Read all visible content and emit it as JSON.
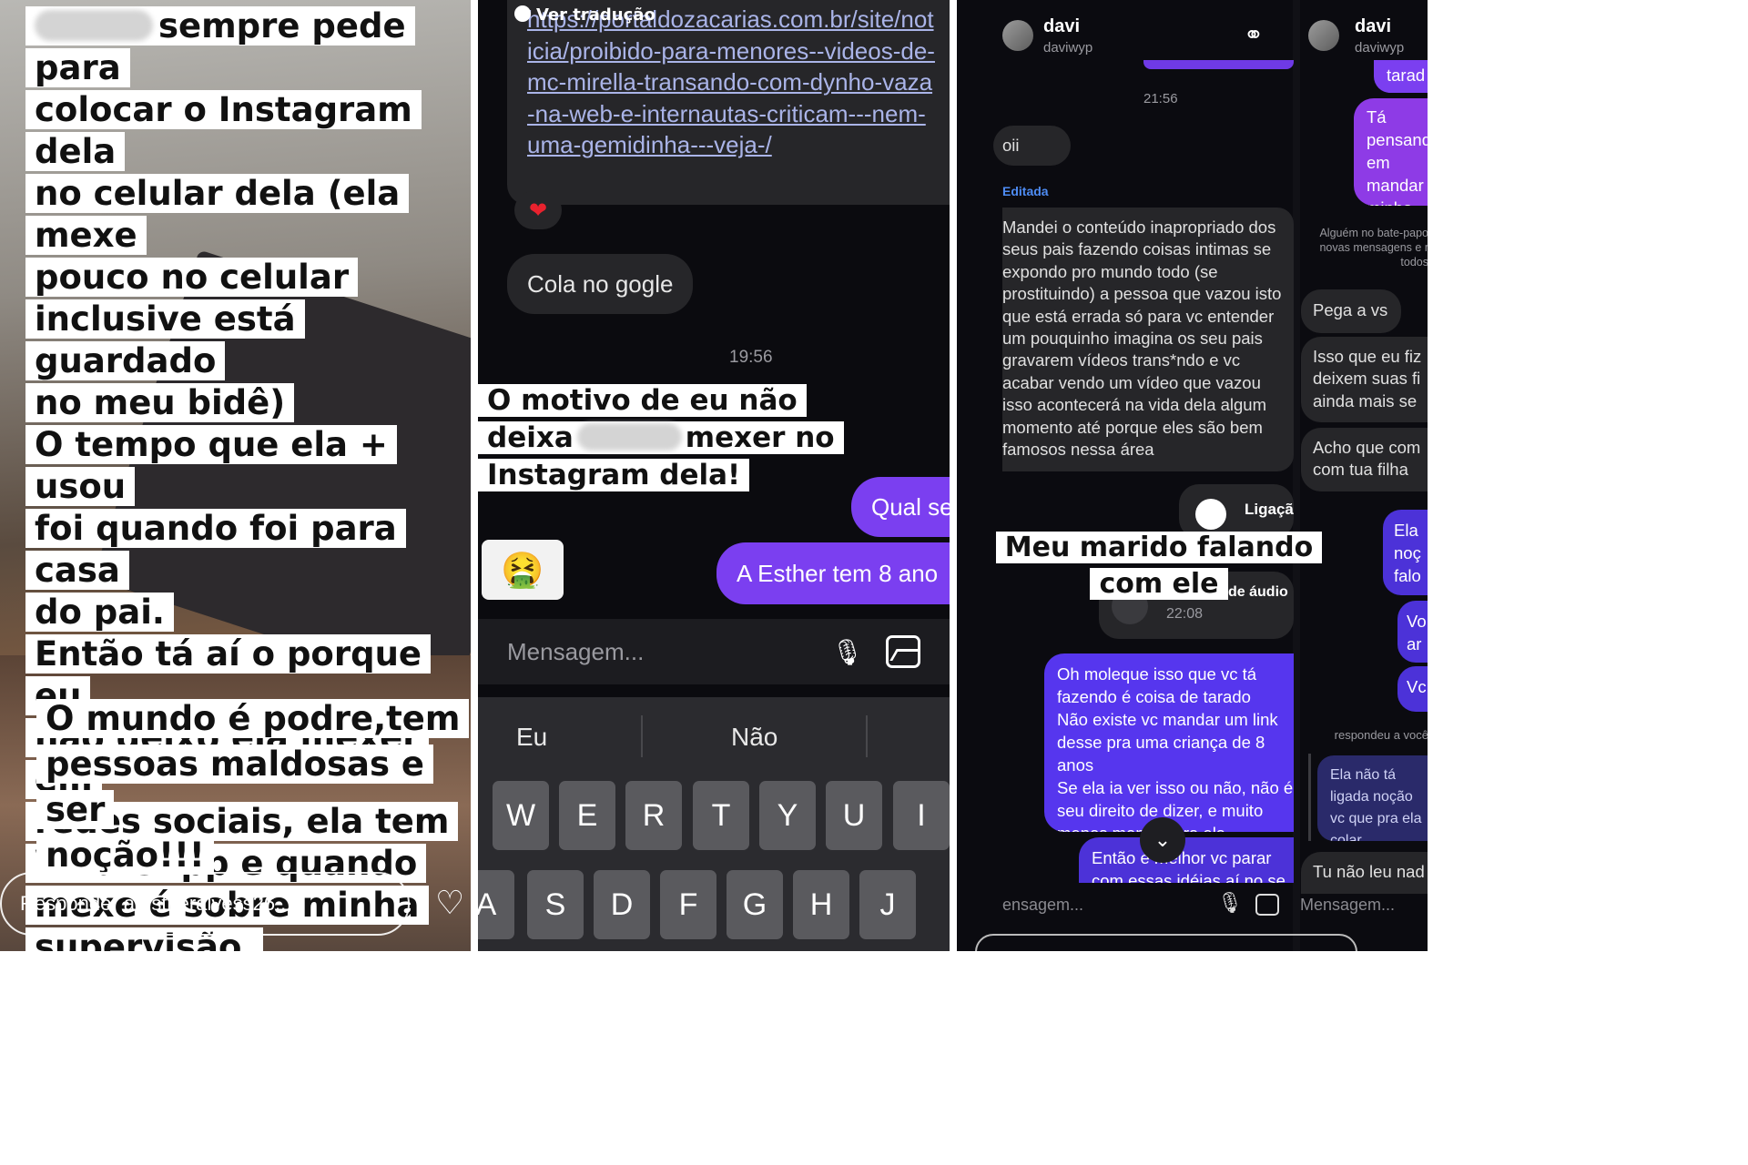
{
  "panel1": {
    "story_lines": [
      "sempre pede para",
      "colocar o Instagram dela",
      "no celular dela (ela mexe",
      "pouco no celular",
      "inclusive está guardado",
      "no meu bidê)",
      "O tempo que ela + usou",
      "foi quando foi para casa",
      "do pai.",
      "Então tá aí o porque eu",
      "não deixo ela mexer em",
      "redes sociais, ela tem",
      "WhatsApp e quando",
      "mexe é sobre minha",
      "supervisão."
    ],
    "story_lines_2": [
      "O mundo é podre,tem",
      "pessoas maldosas e ser",
      "noção!!!"
    ],
    "reply_placeholder": "Responder a estheralvess26...",
    "heart_icon": "♡"
  },
  "panel2": {
    "ver_traducao": "Ver tradução",
    "link_text": "https://portaldozacarias.com.br/site/noticia/proibido-para-menores--videos-de-mc-mirella-transando-com-dynho-vaza-na-web-e-internautas-criticam---nem-uma-gemidinha---veja-/",
    "reaction": "❤",
    "msg_cola": "Cola no gogle",
    "time": "19:56",
    "overlay": {
      "line1": "O motivo de eu não",
      "line2a": "deixa",
      "line2b": "mexer no",
      "line3": "Instagram dela!"
    },
    "out_1": "Qual se",
    "out_2": "A Esther tem 8 ano",
    "emoji": "🤮",
    "input_placeholder": "Mensagem...",
    "suggestions": [
      "Eu",
      "Não"
    ],
    "keys_row1": [
      "W",
      "E",
      "R",
      "T",
      "Y",
      "U",
      "I"
    ],
    "keys_row2": [
      "A",
      "S",
      "D",
      "F",
      "G",
      "H",
      "J"
    ]
  },
  "panel3": {
    "left": {
      "name": "davi",
      "handle": "daviwyp",
      "time": "21:56",
      "msg_oii": "oii",
      "edited": "Editada",
      "long_msg": "Mandei o conteúdo inapropriado dos seus pais fazendo coisas intimas se expondo pro mundo todo (se prostituindo) a pessoa que vazou isto que está errada só para vc entender um pouquinho imagina os seu pais gravarem vídeos trans*ndo e vc acabar vendo um vídeo que vazou isso acontecerá na vida dela algum momento até porque eles são bem famosos nessa área",
      "call_label": "Ligaçã",
      "call_time": "22:07",
      "audio_label": "ção de áudio",
      "audio_time": "22:08",
      "out_msg": "Oh moleque isso que vc tá fazendo é coisa de tarado\nNão existe vc mandar um link desse pra uma criança de 8 anos\nSe ela ia ver isso ou não, não é seu direito de dizer, e muito menos mandar pra ela",
      "out_msg2": "Então é melhor vc parar com essas idéias aí no se não vc vai",
      "input_placeholder": "ensagem..."
    },
    "right": {
      "name": "davi",
      "handle": "daviwyp",
      "out_top": "tarad",
      "out_msg": "Tá pensando em mandar minha filha sem noção",
      "sys_note": "Alguém no bate-papo novas mensagens e r todos",
      "in_1": "Pega a vs",
      "in_2": "Isso que eu fiz deixem suas fi ainda mais se",
      "in_3": "Acho que com com tua filha",
      "out_2": "Ela noç falo",
      "out_3": "Vo ar",
      "out_4": "Vc",
      "replied": "respondeu a você",
      "reply_msg": "Ela não tá ligada noção vc que pra ela colar",
      "in_4": "Tu não leu nad",
      "input_placeholder": "Mensagem..."
    },
    "overlay": "Meu marido falando com ele"
  },
  "colors": {
    "accent_purple": "#7b3ff0",
    "bubble_dark": "#262629",
    "story_white": "#ffffff"
  }
}
